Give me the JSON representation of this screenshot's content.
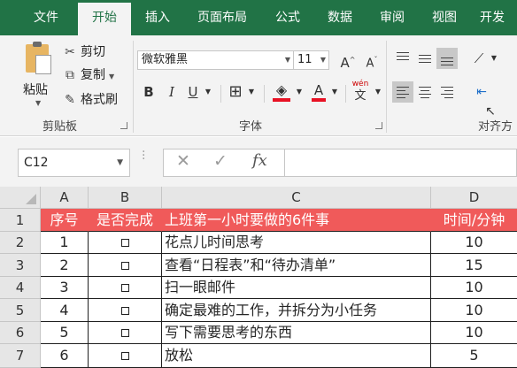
{
  "tabs": [
    "文件",
    "开始",
    "插入",
    "页面布局",
    "公式",
    "数据",
    "审阅",
    "视图",
    "开发"
  ],
  "clipboard": {
    "paste": "粘贴",
    "cut": "剪切",
    "copy": "复制",
    "format_painter": "格式刷",
    "group_label": "剪贴板"
  },
  "font": {
    "name": "微软雅黑",
    "size": "11",
    "grow": "A",
    "shrink": "A",
    "bold": "B",
    "italic": "I",
    "underline": "U",
    "phonetic": "wén",
    "phonetic_glyph": "文",
    "fill_glyph": "A",
    "group_label": "字体"
  },
  "alignment": {
    "group_label": "对齐方"
  },
  "formula_bar": {
    "name_box": "C12",
    "cancel": "✕",
    "enter": "✓",
    "fx": "fx",
    "content": ""
  },
  "columns": [
    "A",
    "B",
    "C",
    "D"
  ],
  "rows": [
    "1",
    "2",
    "3",
    "4",
    "5",
    "6",
    "7"
  ],
  "table": {
    "header": [
      "序号",
      "是否完成",
      "上班第一小时要做的6件事",
      "时间/分钟"
    ],
    "body": [
      [
        "1",
        "□",
        "花点儿时间思考",
        "10"
      ],
      [
        "2",
        "□",
        "查看“日程表”和“待办清单”",
        "15"
      ],
      [
        "3",
        "□",
        "扫一眼邮件",
        "10"
      ],
      [
        "4",
        "□",
        "确定最难的工作，并拆分为小任务",
        "10"
      ],
      [
        "5",
        "□",
        "写下需要思考的东西",
        "10"
      ],
      [
        "6",
        "□",
        "放松",
        "5"
      ]
    ]
  },
  "colors": {
    "ribbon": "#217346",
    "header_fill": "#f05a5a"
  }
}
